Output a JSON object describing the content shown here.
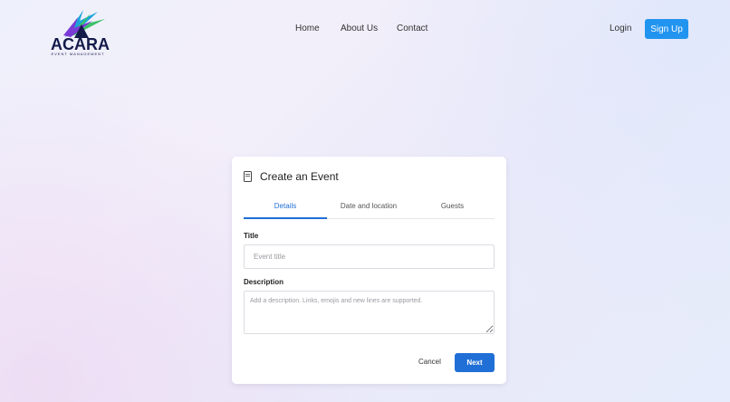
{
  "brand": {
    "name": "ACARA",
    "tagline": "EVENT MANAGEMENT"
  },
  "nav": {
    "items": [
      {
        "label": "Home"
      },
      {
        "label": "About Us"
      },
      {
        "label": "Contact"
      }
    ],
    "login_label": "Login",
    "signup_label": "Sign Up"
  },
  "form": {
    "title": "Create an Event",
    "tabs": [
      {
        "label": "Details",
        "active": true
      },
      {
        "label": "Date and location",
        "active": false
      },
      {
        "label": "Guests",
        "active": false
      }
    ],
    "title_field": {
      "label": "Title",
      "placeholder": "Event title",
      "value": ""
    },
    "description_field": {
      "label": "Description",
      "placeholder": "Add a description. Links, emojis and new lines are supported.",
      "value": ""
    },
    "cancel_label": "Cancel",
    "next_label": "Next"
  },
  "colors": {
    "accent": "#1f6fd6",
    "signup": "#2194f0"
  },
  "icons": {
    "logo": "acara-logo-icon",
    "title": "document-icon"
  }
}
